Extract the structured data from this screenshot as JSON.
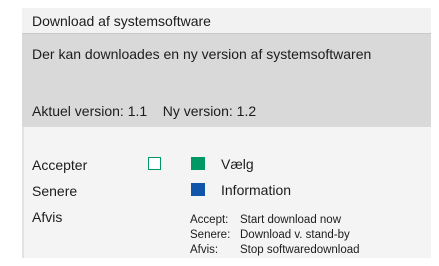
{
  "dialog": {
    "title": "Download af systemsoftware",
    "message": "Der kan downloades en ny version af systemsoftwaren",
    "current_version_label": "Aktuel version:",
    "current_version_value": "1.1",
    "new_version_label": "Ny version:",
    "new_version_value": "1.2"
  },
  "menu": {
    "items": [
      {
        "label": "Accepter"
      },
      {
        "label": "Senere"
      },
      {
        "label": "Afvis"
      }
    ]
  },
  "keys": {
    "select_label": "Vælg",
    "info_label": "Information",
    "select_color": "#009966",
    "info_color": "#1155aa"
  },
  "help": [
    {
      "key": "Accept:",
      "text": "Start download now"
    },
    {
      "key": "Senere:",
      "text": "Download v. stand-by"
    },
    {
      "key": "Afvis:",
      "text": "Stop softwaredownload"
    }
  ]
}
